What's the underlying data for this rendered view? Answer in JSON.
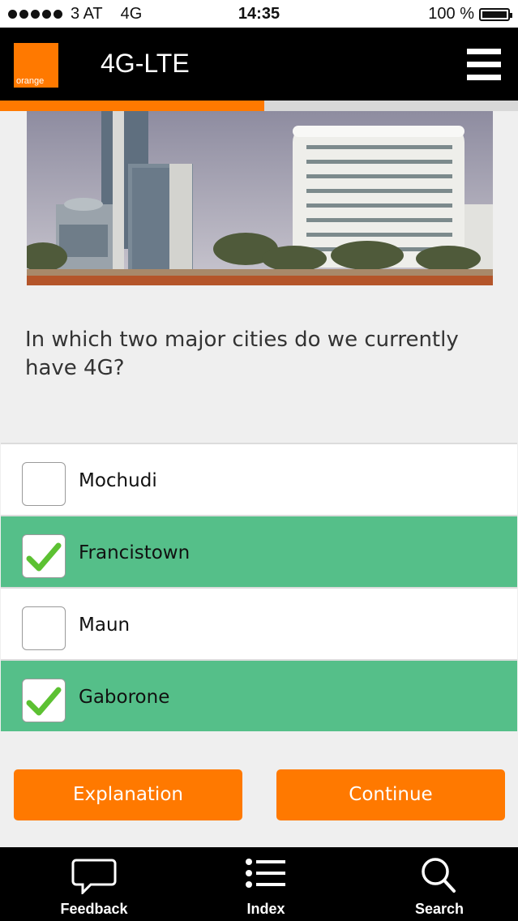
{
  "status_bar": {
    "carrier": "3 AT",
    "network": "4G",
    "time": "14:35",
    "battery": "100 %"
  },
  "header": {
    "logo_text": "orange",
    "title": "4G-LTE",
    "menu_icon": "hamburger-menu-icon"
  },
  "progress": {
    "fraction": 0.51
  },
  "question": {
    "text": "In which two major cities do we currently have 4G?"
  },
  "options": [
    {
      "label": "Mochudi",
      "checked": false
    },
    {
      "label": "Francistown",
      "checked": true
    },
    {
      "label": "Maun",
      "checked": false
    },
    {
      "label": "Gaborone",
      "checked": true
    }
  ],
  "buttons": {
    "explanation": "Explanation",
    "continue": "Continue"
  },
  "tab_bar": [
    {
      "label": "Feedback",
      "icon": "speech-bubble-icon"
    },
    {
      "label": "Index",
      "icon": "list-icon"
    },
    {
      "label": "Search",
      "icon": "search-icon"
    }
  ],
  "colors": {
    "accent": "#ff7900",
    "checked_row": "#55bf89",
    "checkmark": "#5cc132",
    "header_bg": "#000000"
  }
}
